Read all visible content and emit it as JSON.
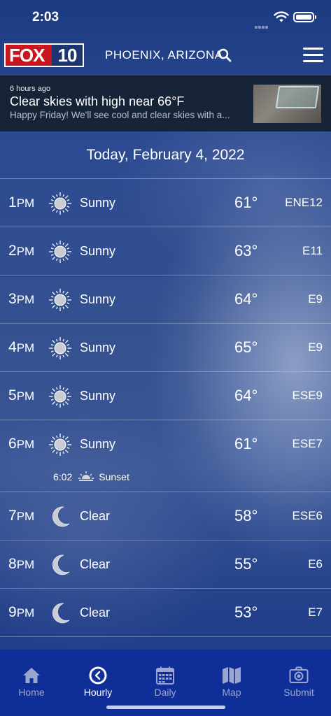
{
  "status_bar": {
    "time": "2:03"
  },
  "header": {
    "logo_text": "FOX",
    "logo_number": "10",
    "location": "PHOENIX, ARIZONA"
  },
  "news": {
    "time_ago": "6 hours ago",
    "title": "Clear skies with high near 66°F",
    "summary": "Happy Friday! We'll see cool and clear skies with a..."
  },
  "date_header": "Today, February 4, 2022",
  "hours": [
    {
      "hour": "1",
      "ampm": "PM",
      "icon": "sun-icon",
      "condition": "Sunny",
      "temp": "61°",
      "wind": "ENE12"
    },
    {
      "hour": "2",
      "ampm": "PM",
      "icon": "sun-icon",
      "condition": "Sunny",
      "temp": "63°",
      "wind": "E11"
    },
    {
      "hour": "3",
      "ampm": "PM",
      "icon": "sun-icon",
      "condition": "Sunny",
      "temp": "64°",
      "wind": "E9"
    },
    {
      "hour": "4",
      "ampm": "PM",
      "icon": "sun-icon",
      "condition": "Sunny",
      "temp": "65°",
      "wind": "E9"
    },
    {
      "hour": "5",
      "ampm": "PM",
      "icon": "sun-icon",
      "condition": "Sunny",
      "temp": "64°",
      "wind": "ESE9"
    },
    {
      "hour": "6",
      "ampm": "PM",
      "icon": "sun-icon",
      "condition": "Sunny",
      "temp": "61°",
      "wind": "ESE7",
      "sunset": {
        "time": "6:02",
        "label": "Sunset"
      }
    },
    {
      "hour": "7",
      "ampm": "PM",
      "icon": "moon-icon",
      "condition": "Clear",
      "temp": "58°",
      "wind": "ESE6"
    },
    {
      "hour": "8",
      "ampm": "PM",
      "icon": "moon-icon",
      "condition": "Clear",
      "temp": "55°",
      "wind": "E6"
    },
    {
      "hour": "9",
      "ampm": "PM",
      "icon": "moon-icon",
      "condition": "Clear",
      "temp": "53°",
      "wind": "E7"
    }
  ],
  "nav": {
    "active": "Hourly",
    "items": [
      {
        "label": "Home",
        "icon": "home-icon"
      },
      {
        "label": "Hourly",
        "icon": "clock-icon"
      },
      {
        "label": "Daily",
        "icon": "calendar-icon"
      },
      {
        "label": "Map",
        "icon": "map-icon"
      },
      {
        "label": "Submit",
        "icon": "camera-icon"
      }
    ]
  }
}
